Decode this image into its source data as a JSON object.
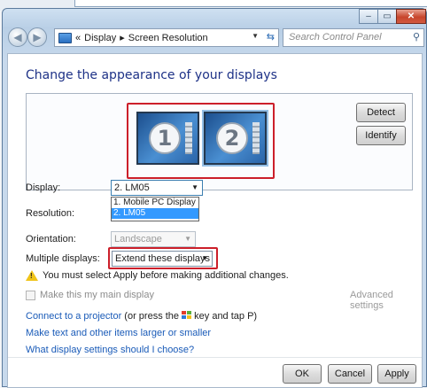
{
  "nav": {
    "breadcrumb_prefix": "«",
    "breadcrumb_1": "Display",
    "breadcrumb_sep": "▸",
    "breadcrumb_2": "Screen Resolution",
    "search_placeholder": "Search Control Panel"
  },
  "window_buttons": {
    "minimize": "‒",
    "maximize": "▭",
    "close": "✕"
  },
  "page": {
    "title": "Change the appearance of your displays",
    "detect_label": "Detect",
    "identify_label": "Identify",
    "monitors": [
      {
        "number": "1"
      },
      {
        "number": "2"
      }
    ]
  },
  "settings": {
    "display_label": "Display:",
    "display_value": "2. LM05",
    "display_options": [
      "1. Mobile PC Display",
      "2. LM05"
    ],
    "resolution_label": "Resolution:",
    "orientation_label": "Orientation:",
    "orientation_value": "Landscape",
    "multiple_label": "Multiple displays:",
    "multiple_value": "Extend these displays"
  },
  "warning": "You must select Apply before making additional changes.",
  "main_display_label": "Make this my main display",
  "advanced_label": "Advanced settings",
  "links": {
    "projector_link": "Connect to a projector",
    "projector_text_1": " (or press the ",
    "projector_text_2": " key and tap P)",
    "text_size_link": "Make text and other items larger or smaller",
    "choose_link": "What display settings should I choose?"
  },
  "buttons": {
    "ok": "OK",
    "cancel": "Cancel",
    "apply": "Apply"
  }
}
